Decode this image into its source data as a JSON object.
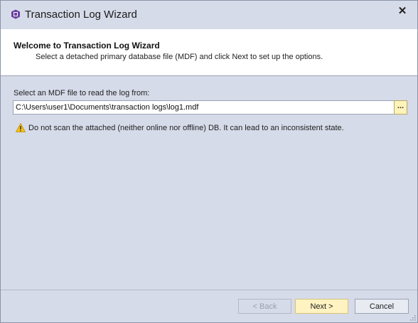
{
  "window": {
    "title": "Transaction Log Wizard",
    "close_glyph": "✕"
  },
  "header": {
    "title": "Welcome to Transaction Log Wizard",
    "subtitle": "Select a detached primary database file (MDF) and click Next to set up the options."
  },
  "form": {
    "label": "Select an MDF file to read the log from:",
    "path_value": "C:\\Users\\user1\\Documents\\transaction logs\\log1.mdf",
    "browse_label": "..."
  },
  "warning": {
    "text": "Do not scan the attached (neither online nor offline) DB. It can lead to an inconsistent state."
  },
  "buttons": {
    "back": "< Back",
    "next": "Next >",
    "cancel": "Cancel"
  },
  "icons": {
    "app": "database-wizard-icon",
    "warning": "warning-icon",
    "close": "close-icon",
    "grip": "resize-grip-icon"
  },
  "colors": {
    "window_bg": "#d6dbe9",
    "accent_button": "#fff3c1",
    "app_icon": "#6b3fa0"
  }
}
